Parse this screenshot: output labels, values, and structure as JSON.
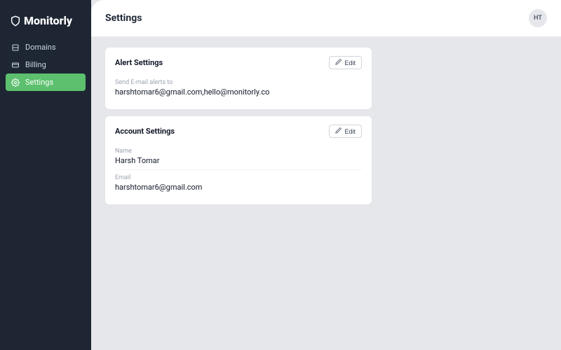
{
  "brand": {
    "name": "Monitorly"
  },
  "sidebar": {
    "items": [
      {
        "label": "Domains"
      },
      {
        "label": "Billing"
      },
      {
        "label": "Settings"
      }
    ]
  },
  "header": {
    "title": "Settings",
    "avatar_initials": "HT"
  },
  "alert_card": {
    "title": "Alert Settings",
    "edit_label": "Edit",
    "send_label": "Send E-mail alerts to",
    "send_value": "harshtomar6@gmail.com,hello@monitorly.co"
  },
  "account_card": {
    "title": "Account Settings",
    "edit_label": "Edit",
    "name_label": "Name",
    "name_value": "Harsh Tomar",
    "email_label": "Email",
    "email_value": "harshtomar6@gmail.com"
  }
}
